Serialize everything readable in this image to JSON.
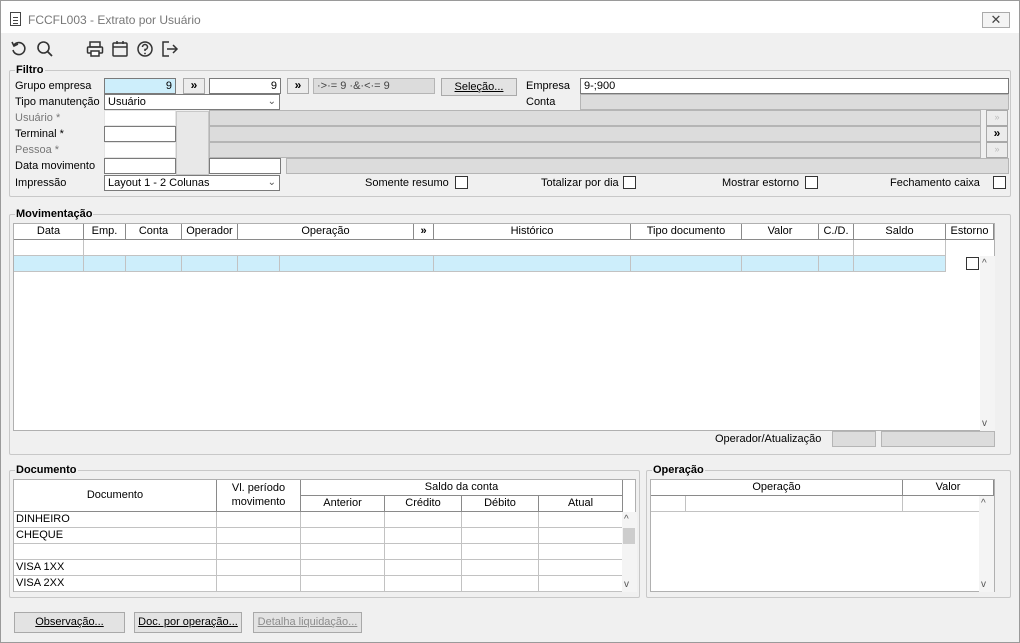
{
  "window": {
    "title": "FCCFL003 - Extrato por Usuário",
    "close_label": "✕"
  },
  "toolbar": {
    "icons": [
      "refresh-icon",
      "search-icon",
      "print-icon",
      "calendar-icon",
      "help-icon",
      "exit-icon"
    ]
  },
  "filtro": {
    "title": "Filtro",
    "grupo_empresa_label": "Grupo empresa",
    "grupo_empresa_from": "9",
    "grupo_empresa_to": "9",
    "expand_label": "»",
    "grupo_expr": "·>·= 9 ·&·<·= 9",
    "selecao_label": "Seleção...",
    "empresa_label": "Empresa",
    "empresa_value": "9-;900",
    "tipo_manutencao_label": "Tipo manutenção",
    "tipo_manutencao_value": "Usuário",
    "conta_label": "Conta",
    "usuario_label": "Usuário *",
    "terminal_label": "Terminal *",
    "pessoa_label": "Pessoa *",
    "data_movimento_label": "Data movimento",
    "impressao_label": "Impressão",
    "impressao_value": "Layout 1 - 2 Colunas",
    "somente_resumo_label": "Somente resumo",
    "totalizar_label": "Totalizar por dia",
    "mostrar_estorno_label": "Mostrar estorno",
    "fechamento_caixa_label": "Fechamento caixa"
  },
  "movimentacao": {
    "title": "Movimentação",
    "columns": [
      "Data",
      "Emp.",
      "Conta",
      "Operador",
      "Operação",
      "»",
      "Histórico",
      "Tipo documento",
      "Valor",
      "C./D.",
      "Saldo",
      "Estorno"
    ],
    "operador_label": "Operador/Atualização"
  },
  "documento": {
    "title": "Documento",
    "col_documento": "Documento",
    "col_vl_periodo": "Vl. período movimento",
    "col_saldo_conta": "Saldo da conta",
    "col_anterior": "Anterior",
    "col_credito": "Crédito",
    "col_debito": "Débito",
    "col_atual": "Atual",
    "rows": [
      "DINHEIRO",
      "CHEQUE",
      "",
      "VISA 1XX",
      "VISA 2XX"
    ]
  },
  "operacao": {
    "title": "Operação",
    "col_operacao": "Operação",
    "col_valor": "Valor"
  },
  "buttons": {
    "observacao": "Observação...",
    "doc_por_operacao": "Doc. por operação...",
    "detalha_liquidacao": "Detalha liquidação..."
  }
}
